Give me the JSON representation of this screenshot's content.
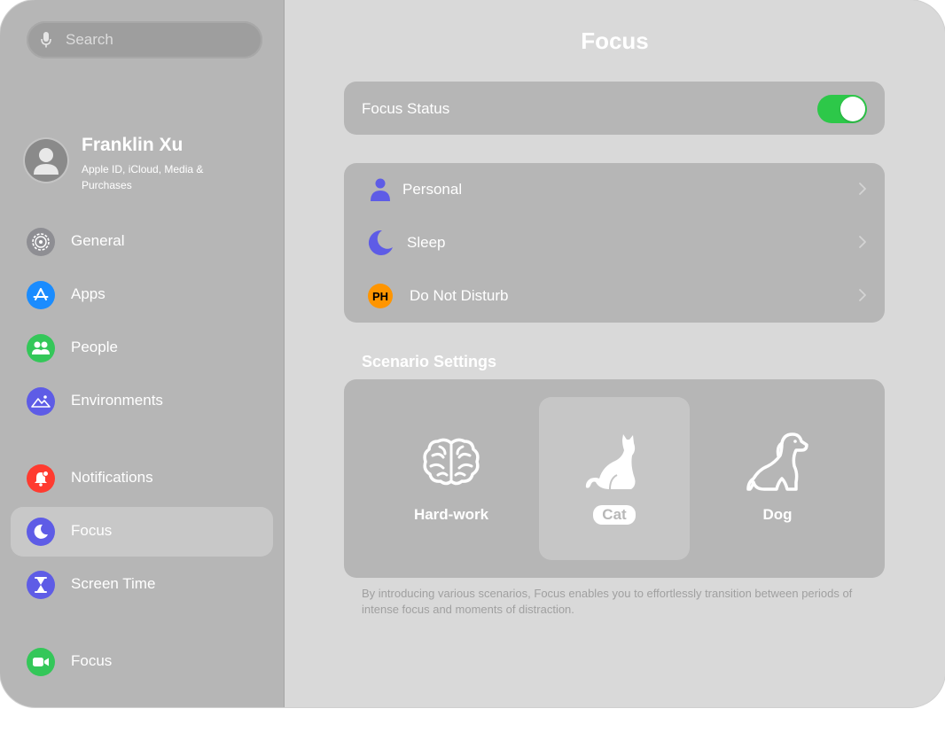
{
  "search": {
    "placeholder": "Search",
    "icon": "mic-icon"
  },
  "profile": {
    "name": "Franklin Xu",
    "subtitle": "Apple ID, iCloud, Media & Purchases"
  },
  "sidebar": {
    "items": [
      {
        "label": "General",
        "icon": "gear-icon",
        "color": "#8e8e93"
      },
      {
        "label": "Apps",
        "icon": "app-store-icon",
        "color": "#1a8cff"
      },
      {
        "label": "People",
        "icon": "people-icon",
        "color": "#34c759"
      },
      {
        "label": "Environments",
        "icon": "mountain-icon",
        "color": "#5e5ce6"
      },
      {
        "label": "Notifications",
        "icon": "bell-icon",
        "color": "#ff3b30"
      },
      {
        "label": "Focus",
        "icon": "moon-icon",
        "color": "#5e5ce6",
        "selected": true
      },
      {
        "label": "Screen Time",
        "icon": "hourglass-icon",
        "color": "#5e5ce6"
      },
      {
        "label": "Focus",
        "icon": "video-camera-icon",
        "color": "#34c759"
      }
    ]
  },
  "main": {
    "title": "Focus",
    "focus_status": {
      "label": "Focus Status",
      "enabled": true
    },
    "modes": [
      {
        "label": "Personal",
        "icon": "person-icon",
        "color": "#5e5ce6"
      },
      {
        "label": "Sleep",
        "icon": "moon-icon",
        "color": "#5e5ce6"
      },
      {
        "label": "Do Not Disturb",
        "icon": "ph-badge-icon",
        "badge_text": "PH",
        "color": "#ff9500"
      }
    ],
    "scenario": {
      "title": "Scenario Settings",
      "items": [
        {
          "label": "Hard-work",
          "icon": "brain-icon"
        },
        {
          "label": "Cat",
          "icon": "cat-icon",
          "selected": true
        },
        {
          "label": "Dog",
          "icon": "dog-icon"
        }
      ],
      "description": "By introducing various scenarios, Focus enables you to effortlessly transition between periods of intense focus and moments of distraction."
    }
  }
}
